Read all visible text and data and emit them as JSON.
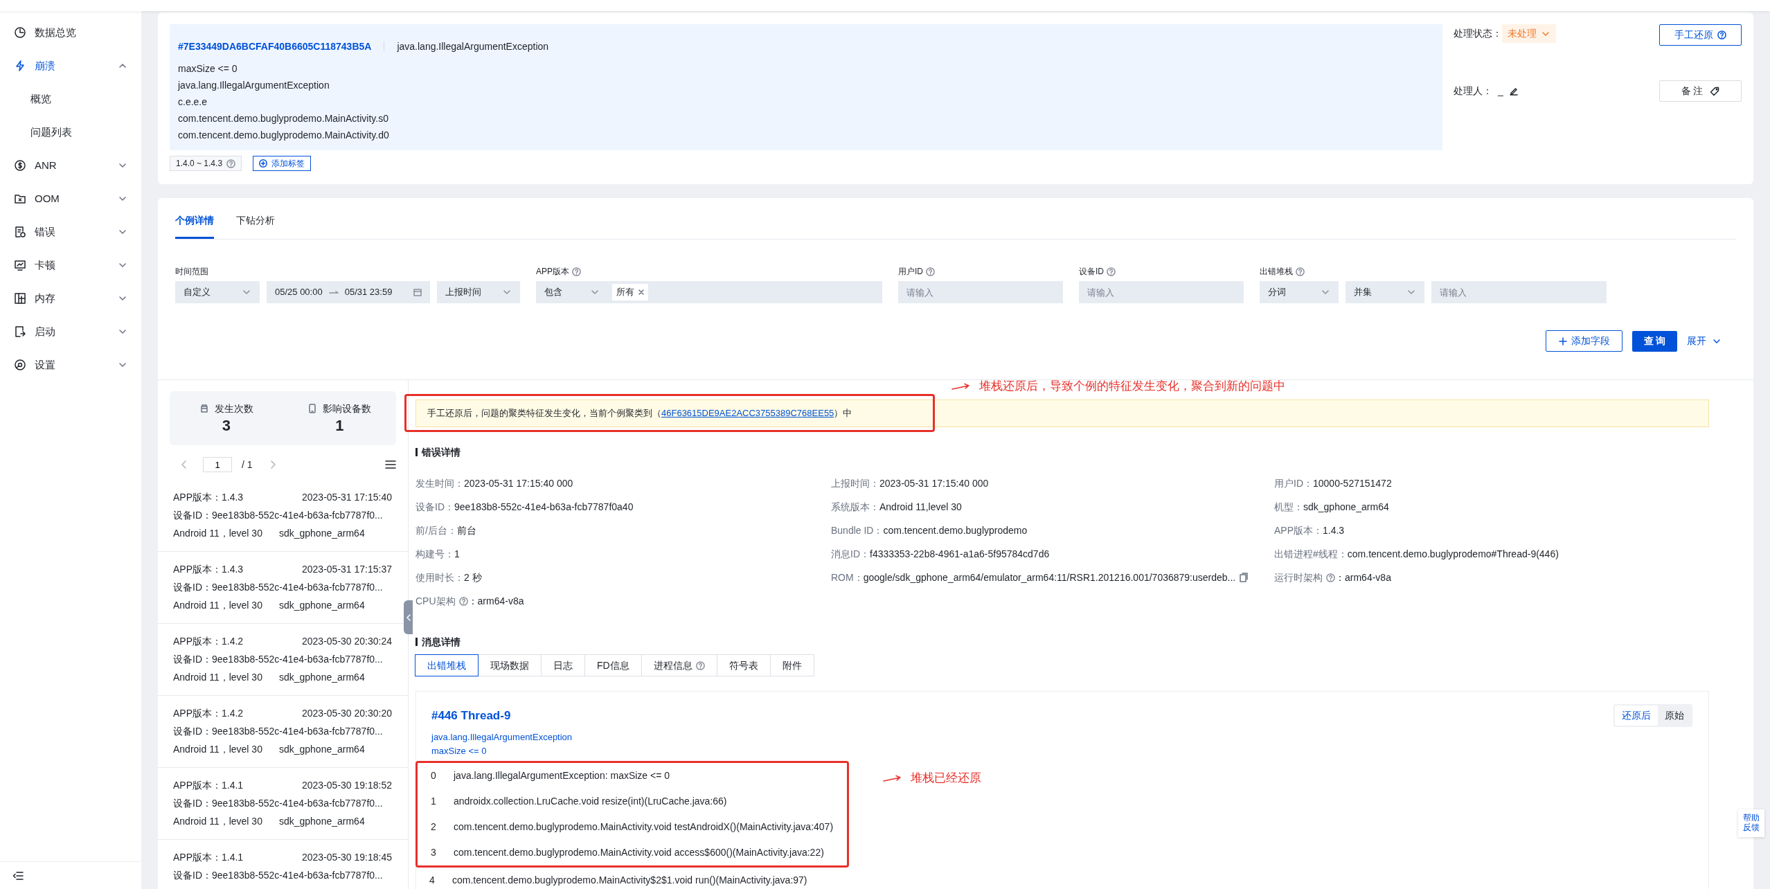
{
  "sidebar": {
    "items": [
      {
        "label": "数据总览",
        "kind": "link",
        "selected": false
      },
      {
        "label": "崩溃",
        "kind": "group",
        "selected": true,
        "expanded": true,
        "children": [
          {
            "label": "概览",
            "selected": false
          },
          {
            "label": "问题列表",
            "selected": false
          }
        ]
      },
      {
        "label": "ANR",
        "kind": "group",
        "selected": false,
        "expanded": false
      },
      {
        "label": "OOM",
        "kind": "group",
        "selected": false,
        "expanded": false
      },
      {
        "label": "错误",
        "kind": "group",
        "selected": false,
        "expanded": false
      },
      {
        "label": "卡顿",
        "kind": "group",
        "selected": false,
        "expanded": false
      },
      {
        "label": "内存",
        "kind": "group",
        "selected": false,
        "expanded": false
      },
      {
        "label": "启动",
        "kind": "group",
        "selected": false,
        "expanded": false
      },
      {
        "label": "设置",
        "kind": "group",
        "selected": false,
        "expanded": false
      }
    ]
  },
  "issue": {
    "id": "#7E33449DA6BCFAF40B6605C118743B5A",
    "type": "java.lang.IllegalArgumentException",
    "lines": [
      "maxSize <= 0",
      "java.lang.IllegalArgumentException",
      "c.e.e.e",
      "com.tencent.demo.buglyprodemo.MainActivity.s0",
      "com.tencent.demo.buglyprodemo.MainActivity.d0"
    ],
    "version_range": "1.4.0 ~ 1.4.3",
    "add_tag": "添加标签",
    "status_label": "处理状态：",
    "status": "未处理",
    "handler_label": "处理人：",
    "handler": "_",
    "restore_button": "手工还原",
    "note_button": "备 注"
  },
  "tabs": [
    {
      "label": "个例详情",
      "selected": true
    },
    {
      "label": "下钻分析",
      "selected": false
    }
  ],
  "filters": [
    {
      "label": "时间范围",
      "help": false,
      "controls": [
        {
          "kind": "select",
          "value": "自定义"
        },
        {
          "kind": "daterange",
          "start": "05/25 00:00",
          "end": "05/31 23:59"
        },
        {
          "kind": "select",
          "value": "上报时间"
        }
      ]
    },
    {
      "label": "APP版本",
      "help": true,
      "controls": [
        {
          "kind": "select",
          "value": "包含"
        },
        {
          "kind": "tags",
          "tags": [
            "所有"
          ]
        }
      ]
    },
    {
      "label": "用户ID",
      "help": true,
      "controls": [
        {
          "kind": "input",
          "placeholder": "请输入"
        }
      ]
    },
    {
      "label": "设备ID",
      "help": true,
      "controls": [
        {
          "kind": "input",
          "placeholder": "请输入"
        }
      ]
    },
    {
      "label": "出错堆栈",
      "help": true,
      "controls": [
        {
          "kind": "select",
          "value": "分词"
        },
        {
          "kind": "select",
          "value": "并集"
        },
        {
          "kind": "input",
          "placeholder": "请输入"
        }
      ]
    }
  ],
  "filter_actions": {
    "add_field": "添加字段",
    "query": "查 询",
    "expand": "展开"
  },
  "stats": [
    {
      "label": "发生次数",
      "value": "3"
    },
    {
      "label": "影响设备数",
      "value": "1"
    }
  ],
  "pager": {
    "page": "1",
    "total": "/ 1"
  },
  "cases": [
    {
      "version": "APP版本：1.4.3",
      "time": "2023-05-31 17:15:40",
      "device": "设备ID：9ee183b8-552c-41e4-b63a-fcb7787f0...",
      "os": "Android 11，level 30",
      "model": "sdk_gphone_arm64"
    },
    {
      "version": "APP版本：1.4.3",
      "time": "2023-05-31 17:15:37",
      "device": "设备ID：9ee183b8-552c-41e4-b63a-fcb7787f0...",
      "os": "Android 11，level 30",
      "model": "sdk_gphone_arm64"
    },
    {
      "version": "APP版本：1.4.2",
      "time": "2023-05-30 20:30:24",
      "device": "设备ID：9ee183b8-552c-41e4-b63a-fcb7787f0...",
      "os": "Android 11，level 30",
      "model": "sdk_gphone_arm64"
    },
    {
      "version": "APP版本：1.4.2",
      "time": "2023-05-30 20:30:20",
      "device": "设备ID：9ee183b8-552c-41e4-b63a-fcb7787f0...",
      "os": "Android 11，level 30",
      "model": "sdk_gphone_arm64"
    },
    {
      "version": "APP版本：1.4.1",
      "time": "2023-05-30 19:18:52",
      "device": "设备ID：9ee183b8-552c-41e4-b63a-fcb7787f0...",
      "os": "Android 11，level 30",
      "model": "sdk_gphone_arm64"
    },
    {
      "version": "APP版本：1.4.1",
      "time": "2023-05-30 19:18:45",
      "device": "设备ID：9ee183b8-552c-41e4-b63a-fcb7787f0..."
    }
  ],
  "banner": {
    "text_before": "手工还原后，问题的聚类特征发生变化，当前个例聚类到（",
    "link": "46F63615DE9AE2ACC3755389C768EE55",
    "text_after": "）中",
    "highlighted": true
  },
  "annotations": [
    {
      "text": "堆栈还原后，导致个例的特征发生变化，聚合到新的问题中"
    },
    {
      "text": "堆栈已经还原"
    }
  ],
  "error_details": {
    "title": "错误详情",
    "fields": [
      {
        "label": "发生时间：",
        "value": "2023-05-31 17:15:40 000"
      },
      {
        "label": "上报时间：",
        "value": "2023-05-31 17:15:40 000"
      },
      {
        "label": "用户ID：",
        "value": "10000-527151472"
      },
      {
        "label": "设备ID：",
        "value": "9ee183b8-552c-41e4-b63a-fcb7787f0a40"
      },
      {
        "label": "系统版本：",
        "value": "Android 11,level 30"
      },
      {
        "label": "机型：",
        "value": "sdk_gphone_arm64"
      },
      {
        "label": "前/后台：",
        "value": "前台"
      },
      {
        "label": "Bundle ID：",
        "value": "com.tencent.demo.buglyprodemo"
      },
      {
        "label": "APP版本：",
        "value": "1.4.3"
      },
      {
        "label": "构建号：",
        "value": "1"
      },
      {
        "label": "消息ID：",
        "value": "f4333353-22b8-4961-a1a6-5f95784cd7d6"
      },
      {
        "label": "出错进程#线程：",
        "value": "com.tencent.demo.buglyprodemo#Thread-9(446)"
      },
      {
        "label": "使用时长：",
        "value": "2 秒"
      },
      {
        "label": "ROM：",
        "value": "google/sdk_gphone_arm64/emulator_arm64:11/RSR1.201216.001/7036879:userdeb...",
        "copy": true
      },
      {
        "label": "运行时架构",
        "help": true,
        "after_help": "：",
        "value": "arm64-v8a"
      },
      {
        "label": "CPU架构",
        "help": true,
        "after_help": "：",
        "value": "arm64-v8a"
      }
    ]
  },
  "message_details": {
    "title": "消息详情",
    "tabs": [
      {
        "label": "出错堆栈",
        "selected": true
      },
      {
        "label": "现场数据",
        "selected": false
      },
      {
        "label": "日志",
        "selected": false
      },
      {
        "label": "FD信息",
        "selected": false
      },
      {
        "label": "进程信息",
        "selected": false,
        "help": true
      },
      {
        "label": "符号表",
        "selected": false
      },
      {
        "label": "附件",
        "selected": false
      }
    ],
    "stack": {
      "thread": "#446 Thread-9",
      "exception": "java.lang.IllegalArgumentException",
      "message": "maxSize <= 0",
      "views": [
        {
          "label": "还原后",
          "selected": true
        },
        {
          "label": "原始",
          "selected": false
        }
      ],
      "frames": [
        {
          "index": "0",
          "text": "java.lang.IllegalArgumentException: maxSize <= 0",
          "highlighted": true
        },
        {
          "index": "1",
          "text": "androidx.collection.LruCache.void resize(int)(LruCache.java:66)",
          "highlighted": true
        },
        {
          "index": "2",
          "text": "com.tencent.demo.buglyprodemo.MainActivity.void testAndroidX()(MainActivity.java:407)",
          "highlighted": true
        },
        {
          "index": "3",
          "text": "com.tencent.demo.buglyprodemo.MainActivity.void access$600()(MainActivity.java:22)",
          "highlighted": true
        },
        {
          "index": "4",
          "text": "com.tencent.demo.buglyprodemo.MainActivity$2$1.void run()(MainActivity.java:97)",
          "highlighted": false
        }
      ]
    }
  },
  "help_button": "帮助反馈"
}
